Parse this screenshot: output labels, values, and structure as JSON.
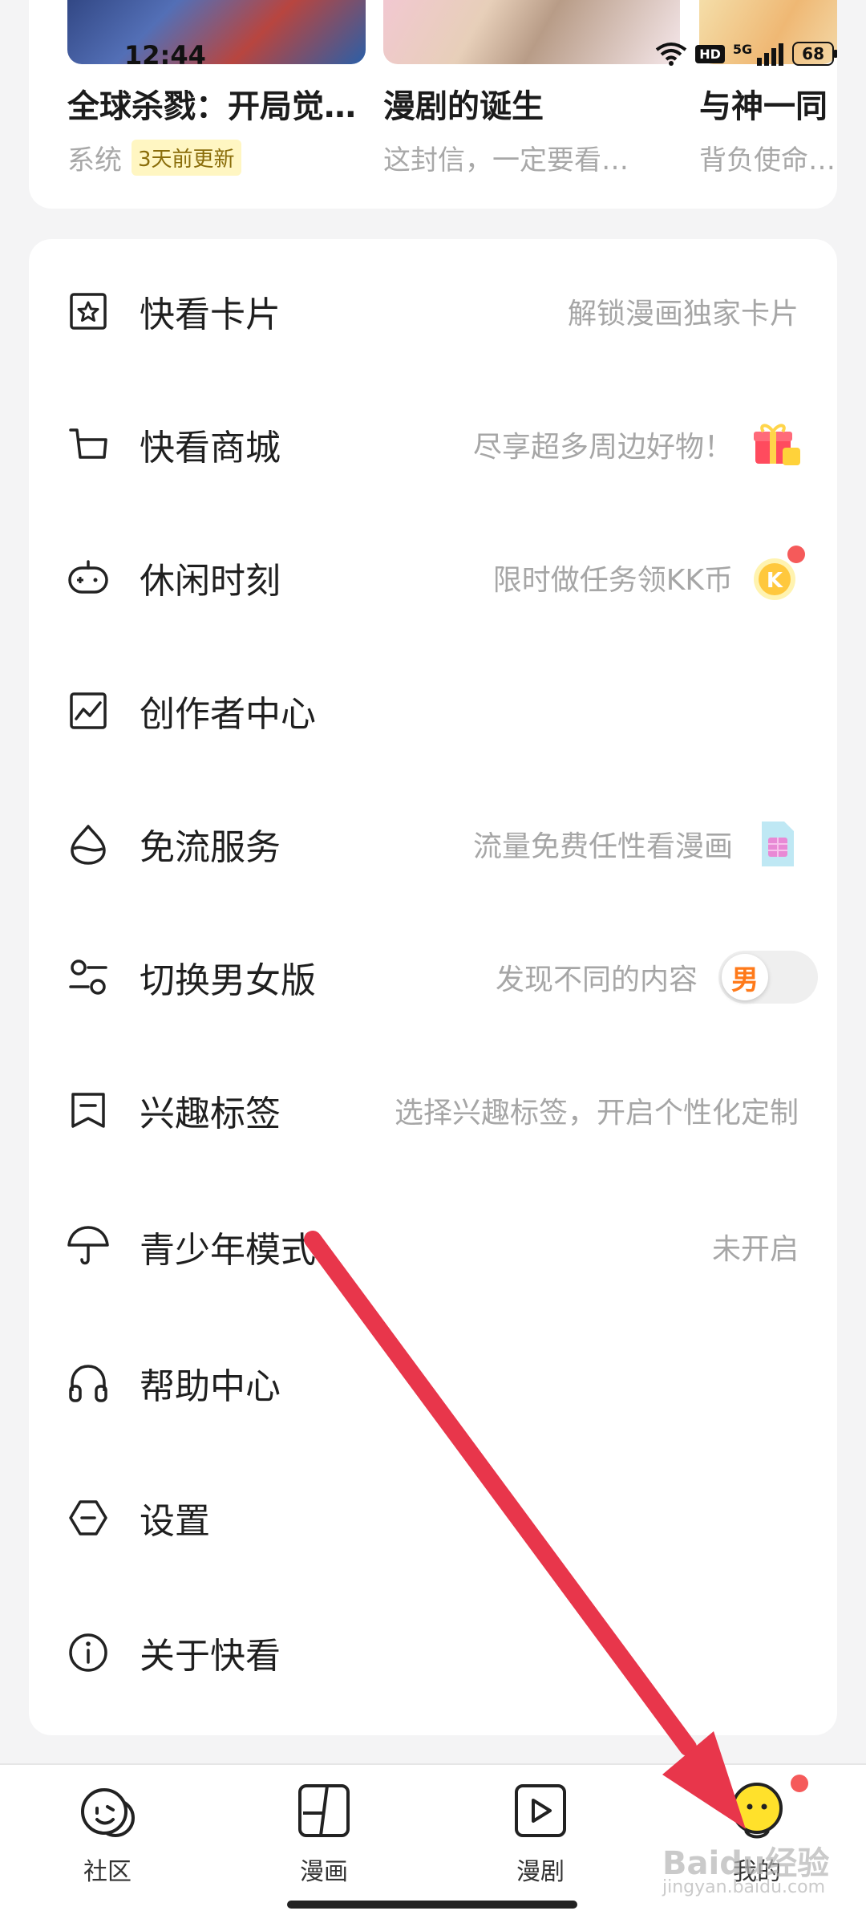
{
  "status_bar": {
    "time": "12:44",
    "network": "5G",
    "hd": "HD",
    "battery": "68"
  },
  "recent": [
    {
      "title": "全球杀戮：开局觉…",
      "subtitle": "系统",
      "tag": "3天前更新"
    },
    {
      "title": "漫剧的诞生",
      "subtitle": "这封信，一定要看…",
      "tag": ""
    },
    {
      "title": "与神一同",
      "subtitle": "背负使命…",
      "tag": ""
    }
  ],
  "menu": [
    {
      "label": "快看卡片",
      "hint": "解锁漫画独家卡片",
      "icon": "star-card-icon"
    },
    {
      "label": "快看商城",
      "hint": "尽享超多周边好物！",
      "icon": "cart-icon",
      "pic": "gift-icon"
    },
    {
      "label": "休闲时刻",
      "hint": "限时做任务领KK币",
      "icon": "gamepad-icon",
      "pic": "kk-coin-icon"
    },
    {
      "label": "创作者中心",
      "hint": "",
      "icon": "chart-icon"
    },
    {
      "label": "免流服务",
      "hint": "流量免费任性看漫画",
      "icon": "drop-icon",
      "pic": "sim-card-icon"
    },
    {
      "label": "切换男女版",
      "hint": "发现不同的内容",
      "icon": "switch-icon",
      "toggle": "男"
    },
    {
      "label": "兴趣标签",
      "hint": "选择兴趣标签，开启个性化定制",
      "icon": "bookmark-icon"
    },
    {
      "label": "青少年模式",
      "hint": "未开启",
      "icon": "umbrella-icon"
    },
    {
      "label": "帮助中心",
      "hint": "",
      "icon": "headphones-icon"
    },
    {
      "label": "设置",
      "hint": "",
      "icon": "settings-icon"
    },
    {
      "label": "关于快看",
      "hint": "",
      "icon": "info-icon"
    }
  ],
  "nav": [
    {
      "label": "社区",
      "icon": "community-icon"
    },
    {
      "label": "漫画",
      "icon": "comic-icon"
    },
    {
      "label": "漫剧",
      "icon": "play-icon"
    },
    {
      "label": "我的",
      "icon": "profile-icon"
    }
  ],
  "watermark": {
    "brand": "Baidu经验",
    "url": "jingyan.baidu.com"
  },
  "colors": {
    "accent": "#ff7a1a",
    "arrow": "#e8364b",
    "badge": "#f55a5a",
    "profile_yellow": "#ffe12b"
  }
}
